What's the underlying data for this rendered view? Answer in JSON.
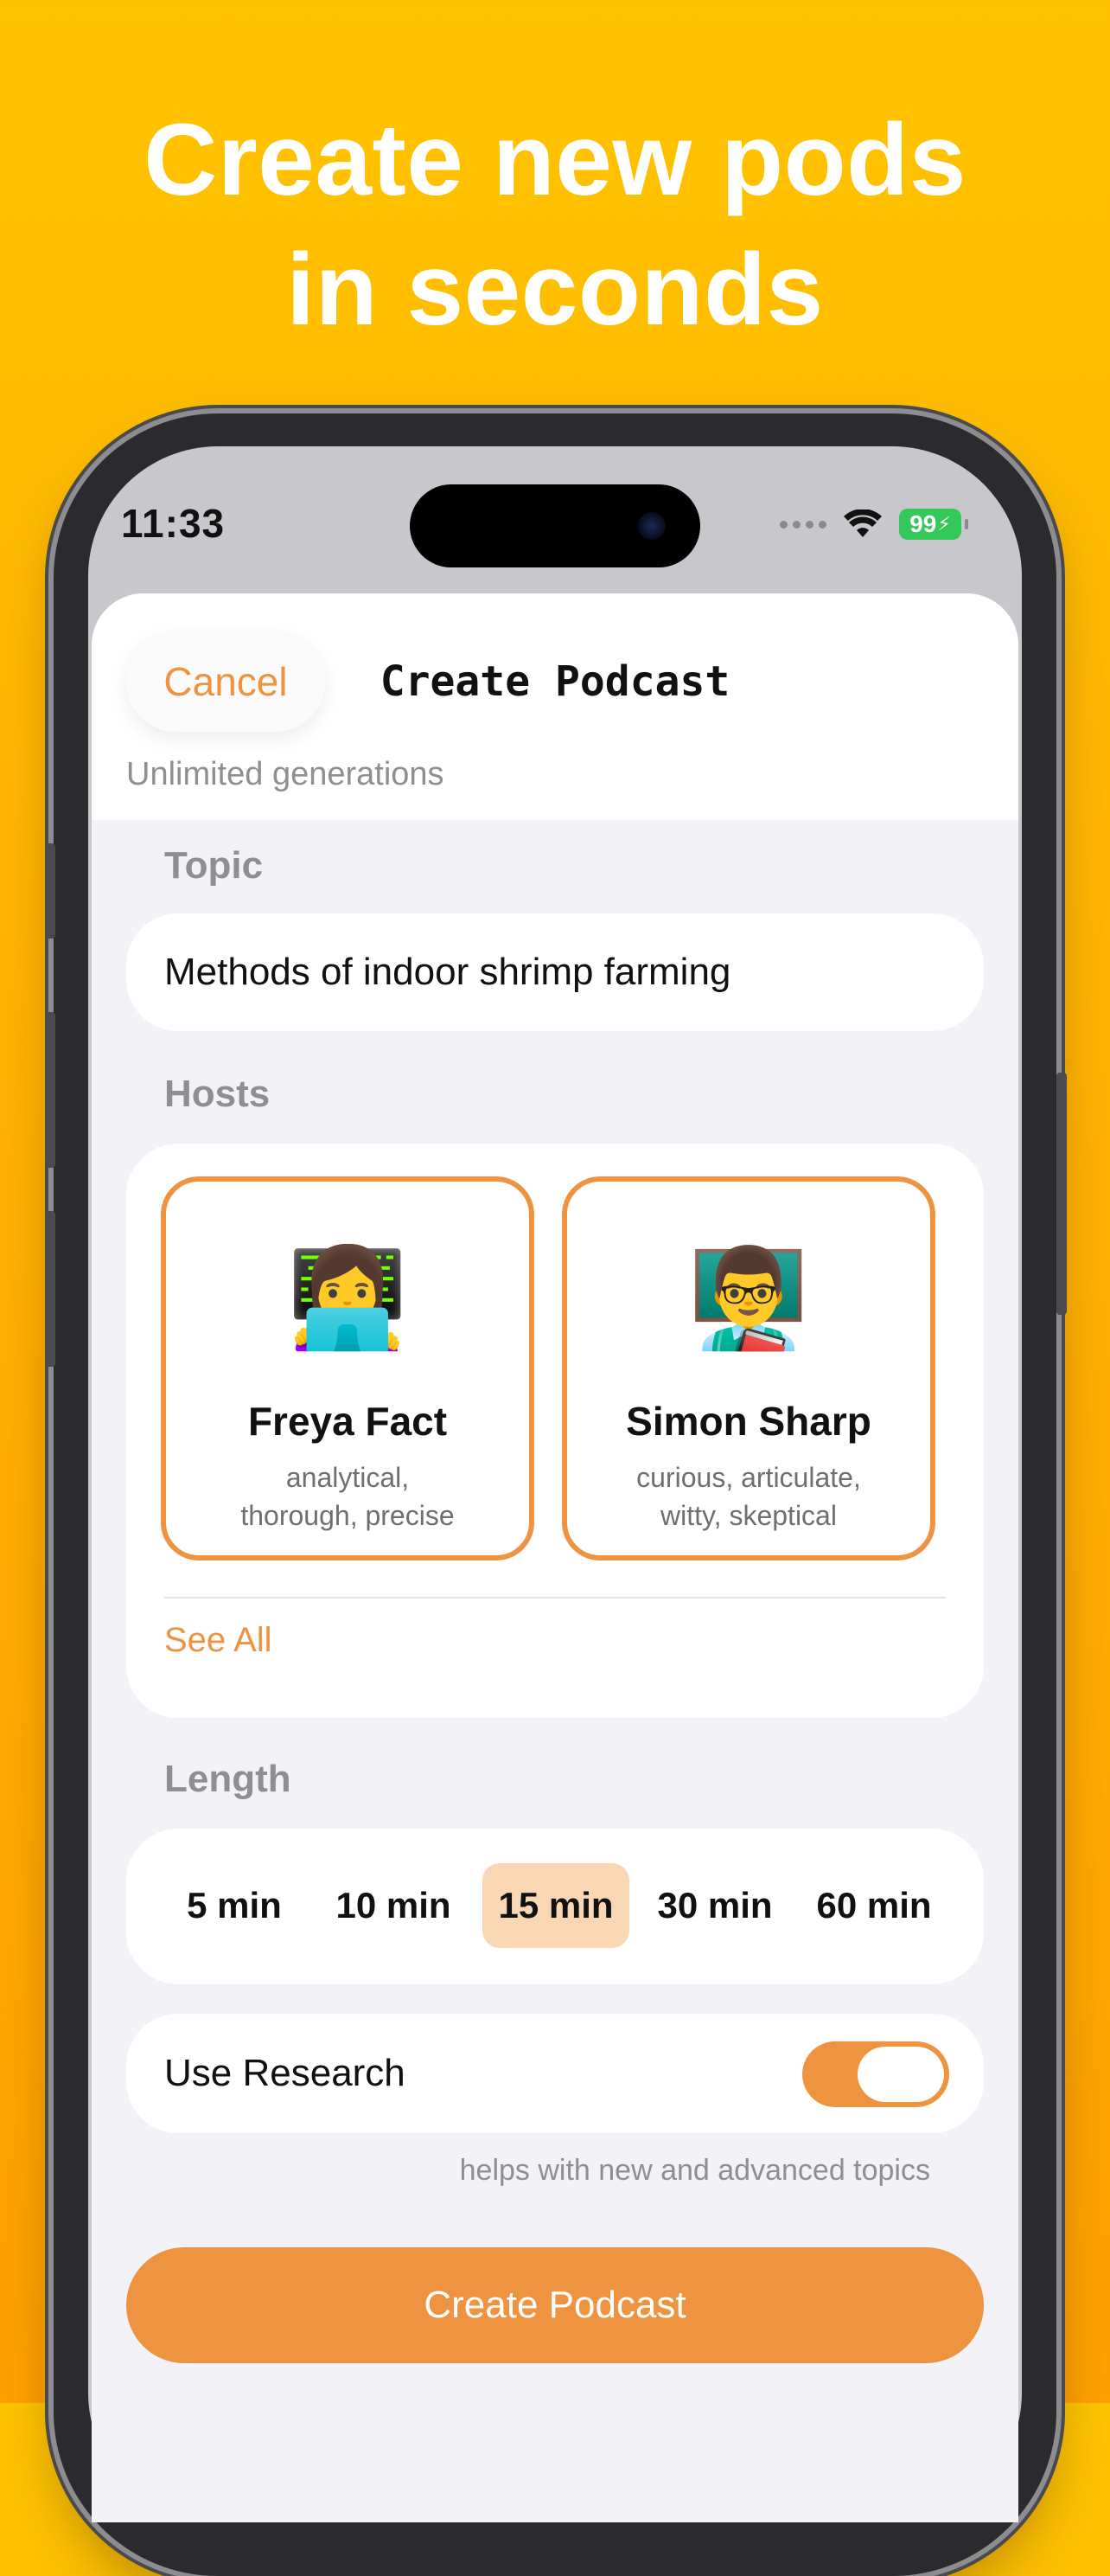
{
  "headline": {
    "line1": "Create new pods",
    "line2": "in seconds"
  },
  "status_bar": {
    "time": "11:33",
    "battery": "99"
  },
  "sheet": {
    "cancel_label": "Cancel",
    "title": "Create Podcast",
    "subtitle": "Unlimited generations"
  },
  "topic": {
    "label": "Topic",
    "value": "Methods of indoor shrimp farming"
  },
  "hosts": {
    "label": "Hosts",
    "items": [
      {
        "emoji": "👩‍💻",
        "name": "Freya Fact",
        "traits_line1": "analytical,",
        "traits_line2": "thorough, precise"
      },
      {
        "emoji": "👨‍🏫",
        "name": "Simon Sharp",
        "traits_line1": "curious, articulate,",
        "traits_line2": "witty, skeptical"
      }
    ],
    "see_all": "See All"
  },
  "length": {
    "label": "Length",
    "options": [
      "5 min",
      "10 min",
      "15 min",
      "30 min",
      "60 min"
    ],
    "selected": "15 min"
  },
  "research": {
    "label": "Use Research",
    "enabled": true,
    "hint": "helps with new and advanced topics"
  },
  "create_button": "Create Podcast",
  "colors": {
    "accent": "#EE9440",
    "accent_light": "#F9D7B5",
    "background_top": "#FFC300",
    "background_bottom": "#FFA000",
    "battery": "#34C759"
  },
  "icons": [
    "wifi-icon",
    "battery-icon",
    "signal-dots-icon"
  ]
}
